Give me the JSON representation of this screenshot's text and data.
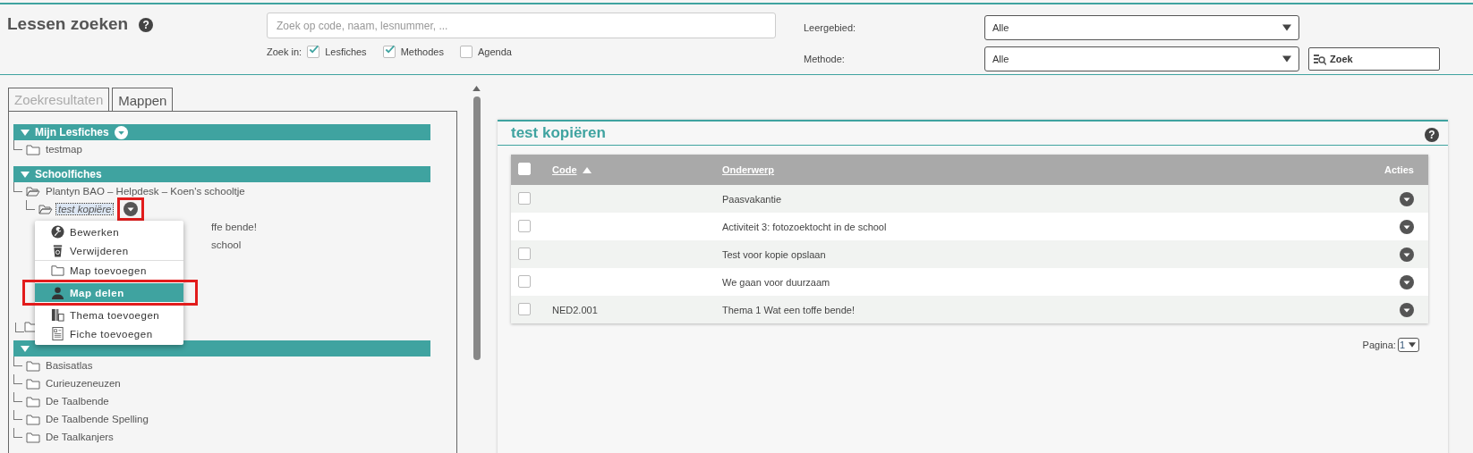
{
  "header": {
    "title": "Lessen zoeken",
    "help": "?",
    "search": {
      "placeholder": "Zoek op code, naam, lesnummer, ..."
    },
    "search_in_label": "Zoek in:",
    "search_in": [
      {
        "label": "Lesfiches",
        "checked": true
      },
      {
        "label": "Methodes",
        "checked": true
      },
      {
        "label": "Agenda",
        "checked": false
      }
    ],
    "filters": [
      {
        "label": "Leergebied:",
        "value": "Alle"
      },
      {
        "label": "Methode:",
        "value": "Alle"
      }
    ],
    "search_button": "Zoek"
  },
  "tabs": [
    {
      "label": "Zoekresultaten",
      "selected": false
    },
    {
      "label": "Mappen",
      "selected": true
    }
  ],
  "sections": [
    {
      "title": "Mijn Lesfiches",
      "expanded": true,
      "has_menu": true,
      "items": [
        {
          "label": "testmap",
          "expanded": false
        }
      ]
    },
    {
      "title": "Schoolfiches",
      "expanded": true,
      "items": [
        {
          "label": "Plantyn BAO – Helpdesk – Koen's schooltje",
          "expanded": true,
          "children": [
            {
              "label": "test kopiëre",
              "expanded": true,
              "selected": true,
              "highlighted": true,
              "children": [
                {
                  "label": "ffe bende!",
                  "kind": "partial"
                },
                {
                  "label": "school",
                  "kind": "partial"
                }
              ]
            }
          ]
        }
      ]
    },
    {
      "expanded": true,
      "items": [
        {
          "label": "Basisatlas",
          "expanded": false
        },
        {
          "label": "Curieuzeneuzen",
          "expanded": false
        },
        {
          "label": "De Taalbende",
          "expanded": false
        },
        {
          "label": "De Taalbende Spelling",
          "expanded": false
        },
        {
          "label": "De Taalkanjers",
          "expanded": false
        }
      ]
    }
  ],
  "context_menu": {
    "items": [
      {
        "label": "Bewerken",
        "kind": "edit",
        "selected": false
      },
      {
        "label": "Verwijderen",
        "kind": "delete",
        "selected": false
      },
      {
        "label": "Map toevoegen",
        "kind": "folder",
        "selected": false,
        "divider_before": true
      },
      {
        "label": "Map delen",
        "kind": "person",
        "selected": true,
        "highlighted": true
      },
      {
        "label": "Thema toevoegen",
        "kind": "theme",
        "selected": false
      },
      {
        "label": "Fiche toevoegen",
        "kind": "sheet",
        "selected": false
      }
    ]
  },
  "folder": {
    "title": "test kopiëren",
    "help": "?",
    "select_all_checked": false,
    "columns": [
      {
        "label": "Code",
        "sorted": true,
        "sort_ascending": true
      },
      {
        "label": "Onderwerp"
      },
      {
        "label": "Acties"
      }
    ],
    "rows": [
      {
        "subject": "Paasvakantie",
        "checked": false
      },
      {
        "subject": "Activiteit 3: fotozoektocht in de school",
        "checked": false
      },
      {
        "subject": "Test voor kopie opslaan",
        "checked": false
      },
      {
        "subject": "We gaan voor duurzaam",
        "checked": false
      },
      {
        "code": "NED2.001",
        "subject": "Thema 1 Wat een toffe bende!",
        "checked": false
      }
    ],
    "pagination": {
      "label": "Pagina:",
      "value": "1"
    }
  }
}
